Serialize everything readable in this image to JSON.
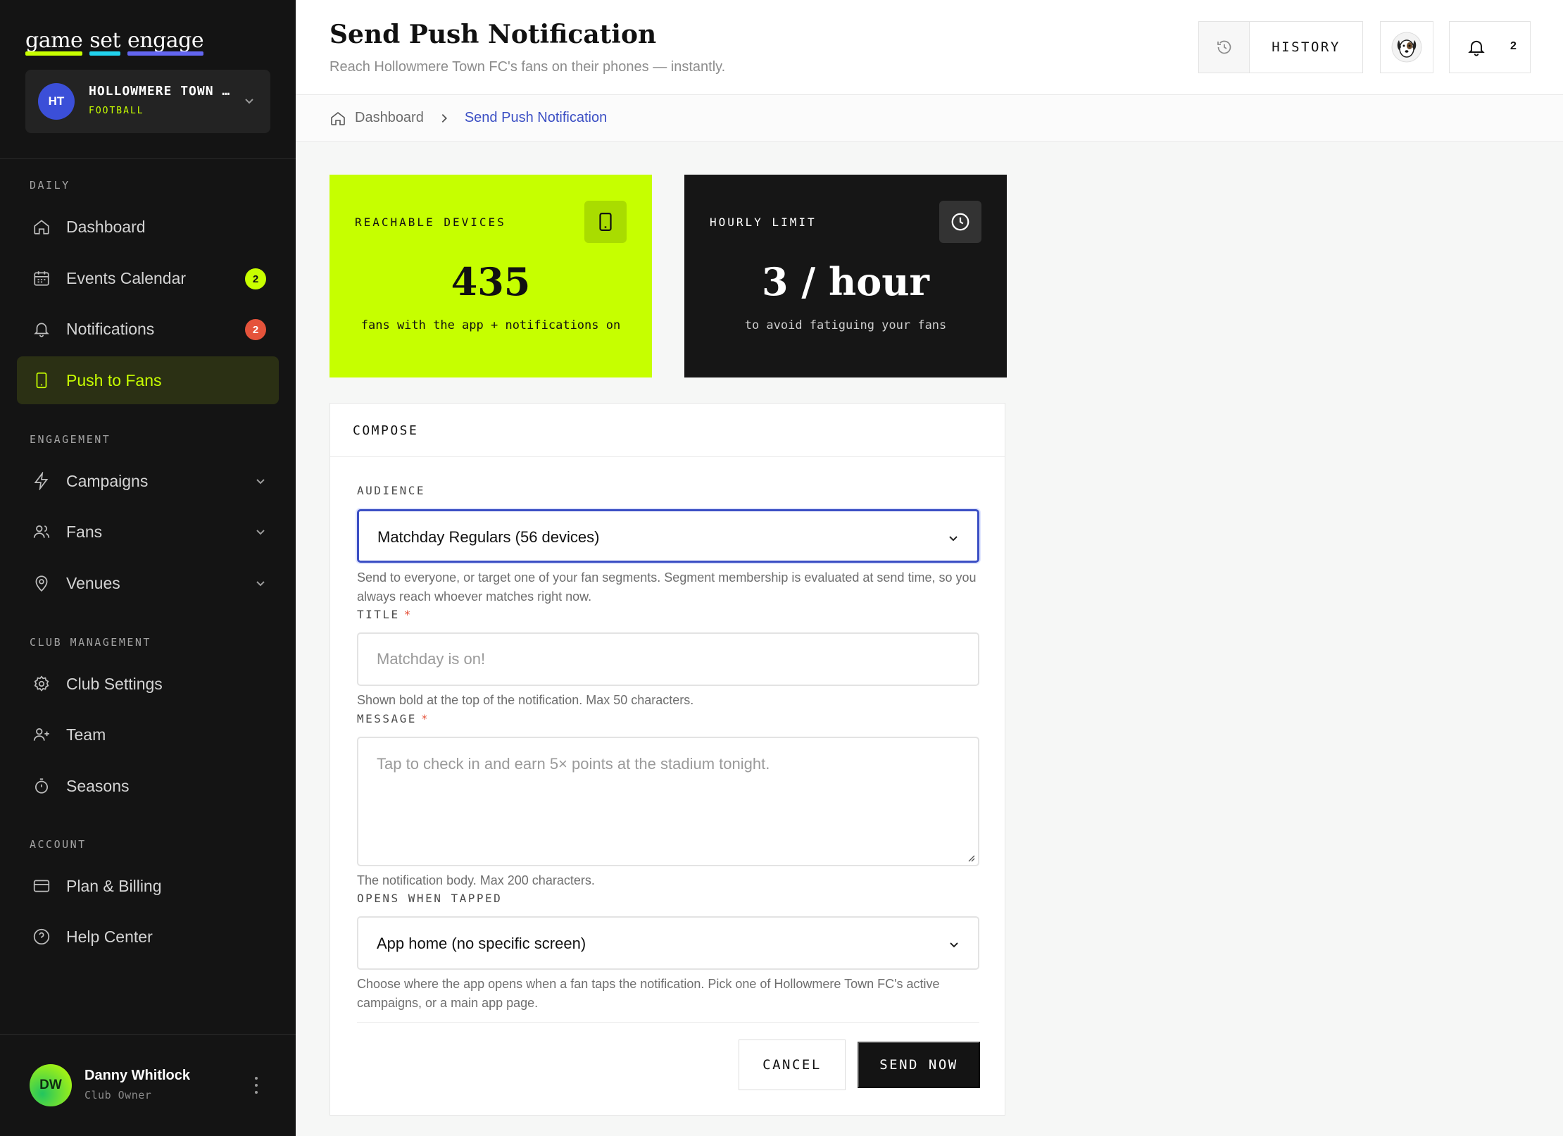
{
  "brand": {
    "logo_word1": "game",
    "logo_word2": "set",
    "logo_word3": "engage"
  },
  "club": {
    "initials": "HT",
    "name": "HOLLOWMERE TOWN FC",
    "sport": "FOOTBALL"
  },
  "sidebar": {
    "sections": [
      {
        "label": "DAILY"
      },
      {
        "label": "ENGAGEMENT"
      },
      {
        "label": "CLUB MANAGEMENT"
      },
      {
        "label": "ACCOUNT"
      }
    ],
    "items": [
      {
        "label": "Dashboard",
        "icon": "home-icon"
      },
      {
        "label": "Events Calendar",
        "icon": "calendar-icon",
        "badge": "2"
      },
      {
        "label": "Notifications",
        "icon": "bell-icon",
        "badge": "2"
      },
      {
        "label": "Push to Fans",
        "icon": "phone-icon",
        "active": true
      },
      {
        "label": "Campaigns",
        "icon": "bolt-icon"
      },
      {
        "label": "Fans",
        "icon": "users-icon"
      },
      {
        "label": "Venues",
        "icon": "map-pin-icon"
      },
      {
        "label": "Club Settings",
        "icon": "gear-icon"
      },
      {
        "label": "Team",
        "icon": "user-plus-icon"
      },
      {
        "label": "Seasons",
        "icon": "stopwatch-icon"
      },
      {
        "label": "Plan & Billing",
        "icon": "credit-card-icon"
      },
      {
        "label": "Help Center",
        "icon": "help-circle-icon"
      }
    ]
  },
  "user": {
    "initials": "DW",
    "name": "Danny Whitlock",
    "role": "Club Owner"
  },
  "header": {
    "title": "Send Push Notification",
    "subtitle": "Reach Hollowmere Town FC's fans on their phones — instantly.",
    "history_label": "HISTORY",
    "notification_count": "2"
  },
  "breadcrumb": {
    "home": "Dashboard",
    "current": "Send Push Notification"
  },
  "stats": {
    "reachable": {
      "label": "REACHABLE DEVICES",
      "value": "435",
      "note": "fans with the app + notifications on"
    },
    "hourly": {
      "label": "HOURLY LIMIT",
      "value": "3 / hour",
      "note": "to avoid fatiguing your fans"
    }
  },
  "compose": {
    "title": "COMPOSE",
    "audience": {
      "label": "AUDIENCE",
      "value": "Matchday Regulars (56 devices)",
      "help": "Send to everyone, or target one of your fan segments. Segment membership is evaluated at send time, so you always reach whoever matches right now."
    },
    "title_field": {
      "label": "TITLE",
      "required": "*",
      "value": "",
      "placeholder": "Matchday is on!",
      "help": "Shown bold at the top of the notification. Max 50 characters."
    },
    "message": {
      "label": "MESSAGE",
      "required": "*",
      "value": "",
      "placeholder": "Tap to check in and earn 5× points at the stadium tonight.",
      "help": "The notification body. Max 200 characters."
    },
    "opens": {
      "label": "OPENS WHEN TAPPED",
      "value": "App home (no specific screen)",
      "help": "Choose where the app opens when a fan taps the notification. Pick one of Hollowmere Town FC's active campaigns, or a main app page."
    },
    "cancel_label": "CANCEL",
    "send_label": "SEND NOW"
  },
  "colors": {
    "accent": "#c6ff00",
    "link": "#3b4fc4",
    "danger": "#e5533b",
    "sidebar_bg": "#141414"
  }
}
